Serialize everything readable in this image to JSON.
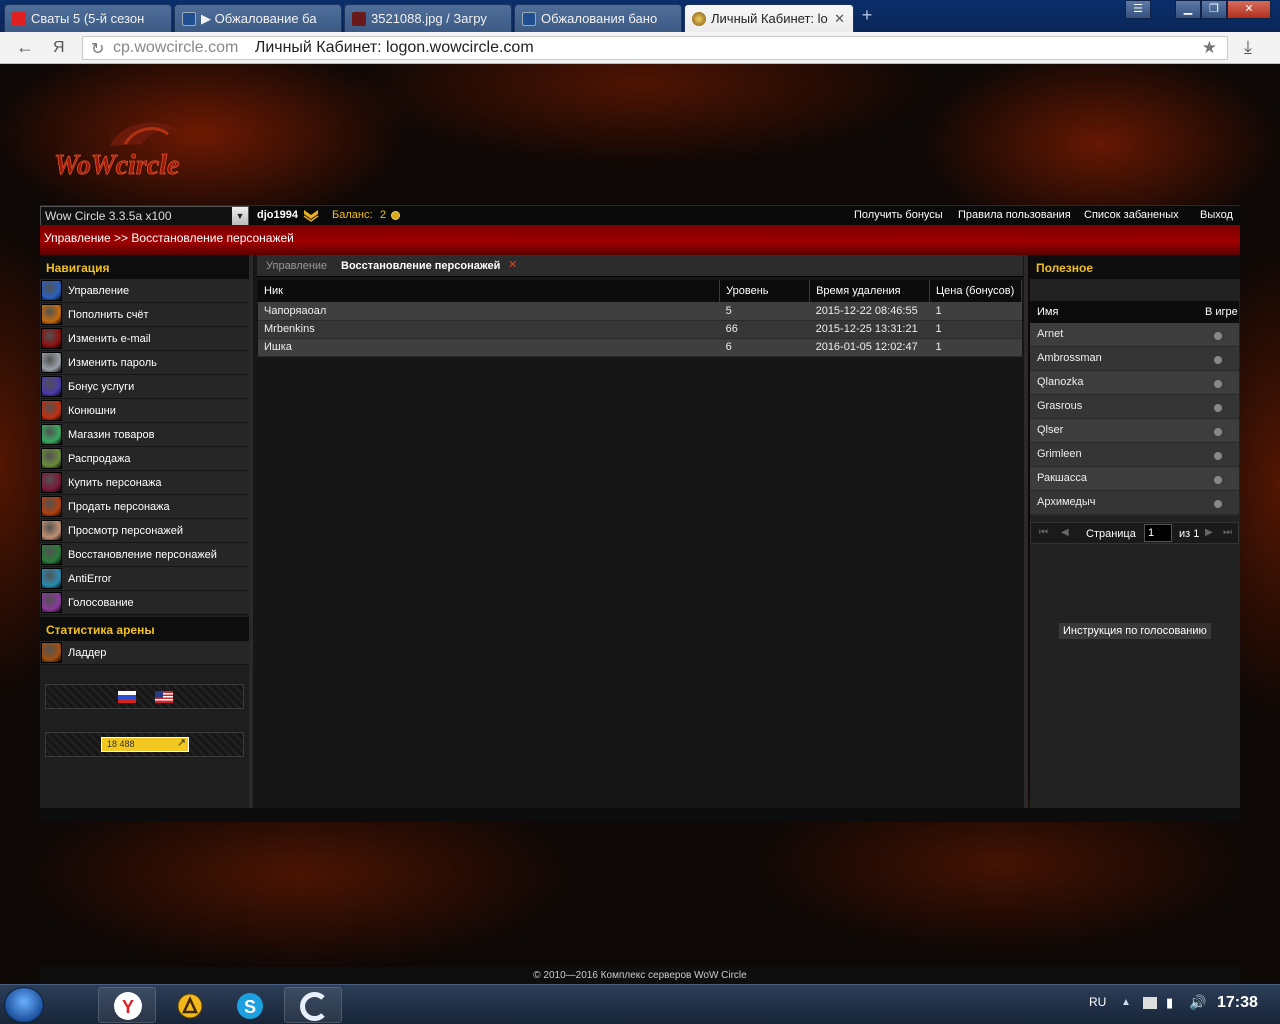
{
  "browser": {
    "tabs": [
      {
        "label": "Сваты 5 (5-й сезон",
        "icon": "youtube-icon",
        "active": false
      },
      {
        "label": "▶ Обжалование ба",
        "icon": "wowcircle-forum-icon",
        "active": false
      },
      {
        "label": "3521088.jpg / Загру",
        "icon": "image-host-icon",
        "active": false
      },
      {
        "label": "Обжалования бано",
        "icon": "wowcircle-forum-icon",
        "active": false
      },
      {
        "label": "Личный Кабинет: lo",
        "icon": "wow-icon",
        "active": true
      }
    ],
    "address_domain": "cp.wowcircle.com",
    "address_title": "Личный Кабинет: logon.wowcircle.com",
    "yandex_glyph": "Я"
  },
  "header": {
    "realm": "Wow Circle 3.3.5a x100",
    "username": "djo1994",
    "balance_label": "Баланс:",
    "balance_value": "2",
    "links": [
      "Получить бонусы",
      "Правила пользования",
      "Список забаненых",
      "Выход"
    ]
  },
  "breadcrumb": "Управление >> Восстановление персонажей",
  "nav": {
    "title": "Навигация",
    "items": [
      {
        "label": "Управление",
        "icon": "control-icon",
        "color": "#2a5fbf"
      },
      {
        "label": "Пополнить счёт",
        "icon": "topup-icon",
        "color": "#c46a10"
      },
      {
        "label": "Изменить e-mail",
        "icon": "email-icon",
        "color": "#8a1010"
      },
      {
        "label": "Изменить пароль",
        "icon": "password-icon",
        "color": "#9aa0a8"
      },
      {
        "label": "Бонус услуги",
        "icon": "bonus-icon",
        "color": "#4a3aa8"
      },
      {
        "label": "Конюшни",
        "icon": "stable-icon",
        "color": "#c03010"
      },
      {
        "label": "Магазин товаров",
        "icon": "shop-icon",
        "color": "#3aa860"
      },
      {
        "label": "Распродажа",
        "icon": "sale-icon",
        "color": "#6a8a3a"
      },
      {
        "label": "Купить персонажа",
        "icon": "buy-character-icon",
        "color": "#7a1a3a"
      },
      {
        "label": "Продать персонажа",
        "icon": "sell-character-icon",
        "color": "#b04010"
      },
      {
        "label": "Просмотр персонажей",
        "icon": "view-characters-icon",
        "color": "#c09070"
      },
      {
        "label": "Восстановление персонажей",
        "icon": "restore-characters-icon",
        "color": "#2a7a3a"
      },
      {
        "label": "AntiError",
        "icon": "antierror-icon",
        "color": "#2a8ab0"
      },
      {
        "label": "Голосование",
        "icon": "voting-icon",
        "color": "#8a3a9a"
      }
    ],
    "arena_title": "Статистика арены",
    "arena_items": [
      {
        "label": "Ладдер",
        "icon": "ladder-icon",
        "color": "#a05010"
      }
    ],
    "counter_text": "18 488"
  },
  "center": {
    "tabs": [
      "Управление",
      "Восстановление персонажей"
    ],
    "columns": [
      "Ник",
      "Уровень",
      "Время удаления",
      "Цена (бонусов)"
    ],
    "rows": [
      [
        "Чапоряаоал",
        "5",
        "2015-12-22 08:46:55",
        "1"
      ],
      [
        "Mrbenkins",
        "66",
        "2015-12-25 13:31:21",
        "1"
      ],
      [
        "Ишка",
        "6",
        "2016-01-05 12:02:47",
        "1"
      ]
    ]
  },
  "useful": {
    "title": "Полезное",
    "columns": [
      "Имя",
      "В игре"
    ],
    "rows": [
      "Arnet",
      "Ambrossman",
      "Qlanozka",
      "Grasrous",
      "Qlser",
      "Grimleen",
      "Ракшасса",
      "Архимедыч"
    ],
    "pager": {
      "page_label": "Страница",
      "page_value": "1",
      "of_label": "из 1"
    },
    "vote_button": "Инструкция по голосованию"
  },
  "footer": "© 2010—2016 Комплекс серверов WoW Circle",
  "taskbar": {
    "apps": [
      "yandex-browser-icon",
      "aimp-icon",
      "skype-icon",
      "qip-icon"
    ],
    "lang": "RU",
    "clock": "17:38"
  }
}
